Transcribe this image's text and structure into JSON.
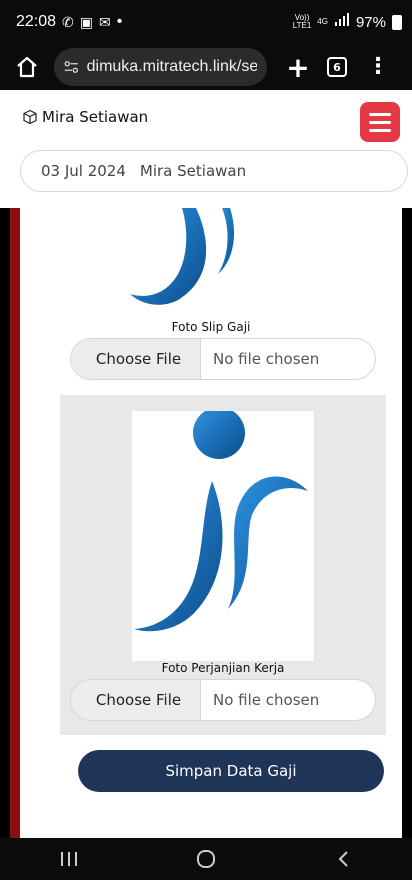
{
  "status_bar": {
    "time": "22:08",
    "notification_icons": [
      "whatsapp-icon",
      "gallery-icon",
      "gmail-icon"
    ],
    "dot": "•",
    "volte_top": "Vo))",
    "volte_bottom": "LTE1",
    "network": "4G",
    "battery": "97%"
  },
  "browser": {
    "url": "dimuka.mitratech.link/settings",
    "tabs_count": "6"
  },
  "header": {
    "user_name": "Mira Setiawan",
    "date": "03 Jul 2024",
    "date_user": "Mira Setiawan"
  },
  "form": {
    "slip_label": "Foto Slip Gaji",
    "agreement_label": "Foto Perjanjian Kerja",
    "choose_file": "Choose File",
    "no_file": "No file chosen",
    "save_button": "Simpan Data Gaji"
  },
  "colors": {
    "accent_red": "#e53845",
    "side_bar": "#8b0f0f",
    "save_button": "#1f3558",
    "logo_blue": "#1e7fd0"
  }
}
